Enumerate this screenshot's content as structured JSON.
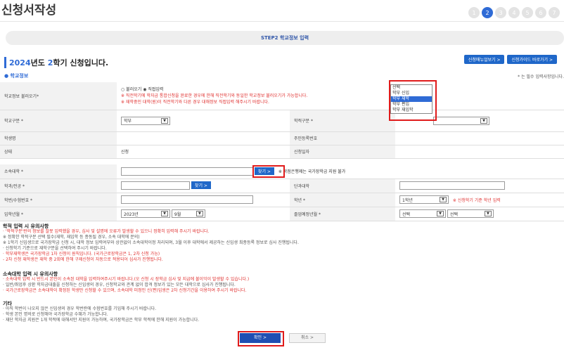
{
  "page": {
    "title": "신청서작성",
    "steps": [
      "1",
      "2",
      "3",
      "4",
      "5",
      "6",
      "7"
    ],
    "active_step": "2",
    "step_bar": "STEP2 학교정보 입력"
  },
  "header": {
    "semester_year": "2024",
    "semester_rest_1": "년도 ",
    "semester_term": "2",
    "semester_rest_2": "학기 신청입니다.",
    "manual_btn": "신청매뉴얼보기 >",
    "guide_btn": "신청가이드 바로가기 >"
  },
  "section": {
    "title": "학교정보",
    "required_note": "* 는 필수 입력사항입니다."
  },
  "form": {
    "load_label": "학교정보 불러오기*",
    "radio_load": "불러오기",
    "radio_direct": "직접입력",
    "load_note1": "※ 직전학기에 학자금 통합신청을 완료한 경우에 한해 직전학기와 동일한 학교정보 불러오기가 가능합니다.",
    "load_note2": "※ 재학중인 대학(원)이 직전학기와 다른 경우 대해정보 직접입력 해주시기 바랍니다.",
    "school_type_label": "학교구분 *",
    "school_type_value": "학부",
    "academic_status_label": "학적구분 *",
    "student_name_label": "학생명",
    "rrn_label": "주민등록번호",
    "status_label": "상태",
    "status_value": "신청",
    "apply_date_label": "신청일자",
    "university_label": "소속대학 *",
    "find_btn": "찾기 >",
    "university_note": "※ 학점은행제는 국가장학금 지원 불가",
    "dept_label": "학과/전공 *",
    "dept_find_btn": "찾기 >",
    "college_label": "단과대학",
    "student_id_label": "학번/수험번호 *",
    "grade_label": "학년 *",
    "grade_value": "1학년",
    "grade_note": "※ 신청학기 기준 학년 입력",
    "admission_label": "입학년월 *",
    "admission_year": "2023년",
    "admission_month": "9월",
    "graduation_label": "졸업예정년월 *",
    "grad_sel1": "선택",
    "grad_sel2": "선택"
  },
  "dropdown": {
    "options": [
      "선택",
      "학부 신입",
      "학부 재학",
      "학부 편입",
      "학부 재입학"
    ],
    "selected": "학부 재학"
  },
  "notes": {
    "h1": "학적 입력 시 유의사항",
    "n1": "· '학적구분'란의 정보를 잘못 입력했을 경우, 심사 및 설명에 오류가 발생할 수 있으니 정확히 입력해 주시기 바랍니다.",
    "n2": "  ※ 정확한 학적구분 선택 필수(재학, 재입학 등 종동될 경우, 소속 대학에 문의)",
    "n3": "  ※ 1학기 신입생으로 국가장학금 신청 시, 대학 정보 입력여부와 상관없이 소속대학이정 처리되며, 3월 이후 대학에서 제공하는 신입생 최종등록 정보로 심사 진행됩니다.",
    "n4": "· 신청학기 기준으로 재학구분을 선택하여 주시기 바랍니다.",
    "n5": "· 학부재학생은 국가장학금 1차 신청이 원칙입니다. (국가근로장학금은 1, 2차 신청 가능)",
    "n6": "  - 2차 신청 재학생은 재학 중 2회에 한해 구제신청이 자동으로 적용되어 심사가 진행됩니다.",
    "h2": "소속대학 입력 시 유의사항",
    "m1": "· 소속대학 입력 시 반드시 본인이 소속된 대학을 입력하여주시기 바랍니다.(오 신청 시 장학금 심사 및 지급에 불이익이 발생할 수 있습니다.)",
    "m2": "· 일반/취업후 상환 학자금대출을 신청하는 신입생의 경우, 신청학교와 관계 없이 합격 정보가 있는 모든 대학으로 심사가 진행됩니다.",
    "m3": "· 국가근로장학금은 소속대학이 확정된 학생만 신청할 수 있으며, 소속대학 미정인 신(편)입생은 2차 신청기간을 이용하여 주시기 바랍니다.",
    "h3": "기타",
    "k1": "· 아직 학번이 나오지 않은 신입생의 경우 학번란에 수험번호를 기입해 주시기 바랍니다.",
    "k2": "· 학생 본인 명의로 신청해야 국가장학금 수혜가 가능합니다.",
    "k3": "· 재단 학자금 지원은 1개 학적에 대해서만 지원이 가능하며, 국가장학금은 학부 학적에 한해 지원이 가능합니다."
  },
  "buttons": {
    "confirm": "확인 >",
    "cancel": "취소 >"
  },
  "colors": {
    "accent": "#2f6bd6",
    "warning": "#e0302f",
    "highlight_box": "#e01b1b"
  }
}
